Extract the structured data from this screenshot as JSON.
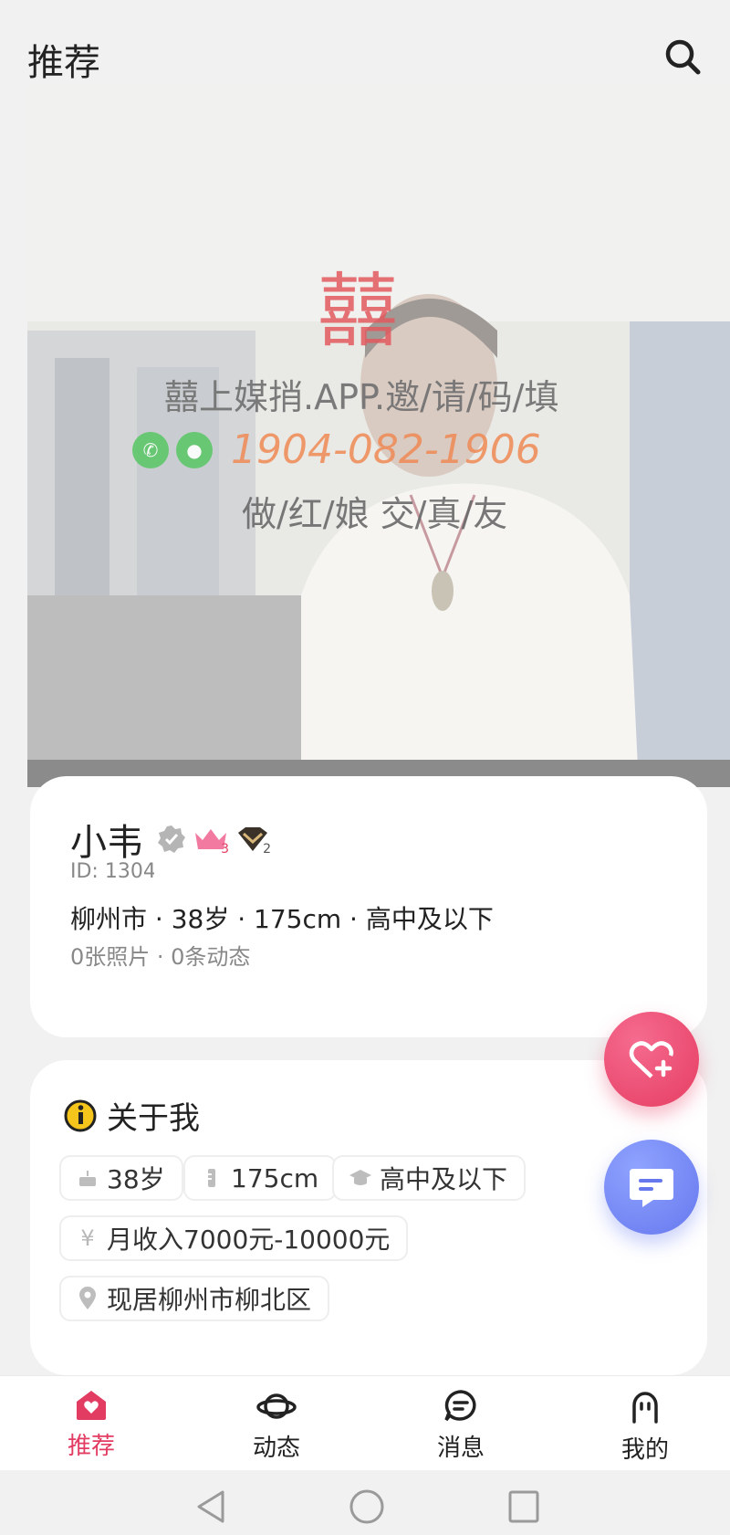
{
  "header": {
    "title": "推荐",
    "search_icon": "search-icon"
  },
  "photo": {
    "watermark_logo": "囍",
    "watermark_line1": "囍上媒捎.APP.邀/请/码/填",
    "watermark_phone": "1904-082-1906",
    "watermark_line3": "做/红/娘 交/真/友"
  },
  "profile": {
    "name": "小韦",
    "id": "ID: 1304",
    "details": "柳州市 · 38岁 · 175cm · 高中及以下",
    "stats": "0张照片 · 0条动态",
    "crown_level": "3",
    "vip_level": "2"
  },
  "about": {
    "title": "关于我",
    "tags": [
      {
        "icon": "cake-icon",
        "label": "38岁"
      },
      {
        "icon": "height-icon",
        "label": "175cm"
      },
      {
        "icon": "graduation-cap-icon",
        "label": "高中及以下"
      },
      {
        "icon": "yuan-icon",
        "label": "月收入7000元-10000元"
      },
      {
        "icon": "location-pin-icon",
        "label": "现居柳州市柳北区"
      }
    ]
  },
  "bottom_nav": [
    {
      "label": "推荐",
      "icon": "home-heart-icon",
      "active": true
    },
    {
      "label": "动态",
      "icon": "planet-icon",
      "active": false
    },
    {
      "label": "消息",
      "icon": "message-icon",
      "active": false
    },
    {
      "label": "我的",
      "icon": "profile-icon",
      "active": false
    }
  ],
  "colors": {
    "accent": "#e23c63",
    "chat_button": "#6678ee",
    "like_button": "#e63d62"
  }
}
